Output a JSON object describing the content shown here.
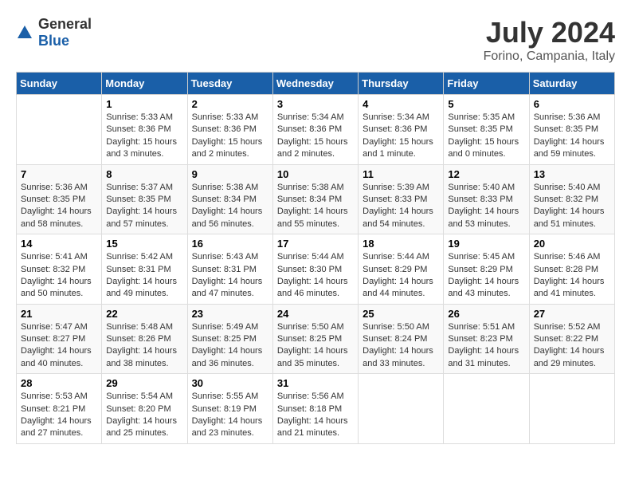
{
  "logo": {
    "general": "General",
    "blue": "Blue"
  },
  "header": {
    "month_year": "July 2024",
    "location": "Forino, Campania, Italy"
  },
  "weekdays": [
    "Sunday",
    "Monday",
    "Tuesday",
    "Wednesday",
    "Thursday",
    "Friday",
    "Saturday"
  ],
  "weeks": [
    [
      {
        "day": "",
        "sunrise": "",
        "sunset": "",
        "daylight": ""
      },
      {
        "day": "1",
        "sunrise": "Sunrise: 5:33 AM",
        "sunset": "Sunset: 8:36 PM",
        "daylight": "Daylight: 15 hours and 3 minutes."
      },
      {
        "day": "2",
        "sunrise": "Sunrise: 5:33 AM",
        "sunset": "Sunset: 8:36 PM",
        "daylight": "Daylight: 15 hours and 2 minutes."
      },
      {
        "day": "3",
        "sunrise": "Sunrise: 5:34 AM",
        "sunset": "Sunset: 8:36 PM",
        "daylight": "Daylight: 15 hours and 2 minutes."
      },
      {
        "day": "4",
        "sunrise": "Sunrise: 5:34 AM",
        "sunset": "Sunset: 8:36 PM",
        "daylight": "Daylight: 15 hours and 1 minute."
      },
      {
        "day": "5",
        "sunrise": "Sunrise: 5:35 AM",
        "sunset": "Sunset: 8:35 PM",
        "daylight": "Daylight: 15 hours and 0 minutes."
      },
      {
        "day": "6",
        "sunrise": "Sunrise: 5:36 AM",
        "sunset": "Sunset: 8:35 PM",
        "daylight": "Daylight: 14 hours and 59 minutes."
      }
    ],
    [
      {
        "day": "7",
        "sunrise": "Sunrise: 5:36 AM",
        "sunset": "Sunset: 8:35 PM",
        "daylight": "Daylight: 14 hours and 58 minutes."
      },
      {
        "day": "8",
        "sunrise": "Sunrise: 5:37 AM",
        "sunset": "Sunset: 8:35 PM",
        "daylight": "Daylight: 14 hours and 57 minutes."
      },
      {
        "day": "9",
        "sunrise": "Sunrise: 5:38 AM",
        "sunset": "Sunset: 8:34 PM",
        "daylight": "Daylight: 14 hours and 56 minutes."
      },
      {
        "day": "10",
        "sunrise": "Sunrise: 5:38 AM",
        "sunset": "Sunset: 8:34 PM",
        "daylight": "Daylight: 14 hours and 55 minutes."
      },
      {
        "day": "11",
        "sunrise": "Sunrise: 5:39 AM",
        "sunset": "Sunset: 8:33 PM",
        "daylight": "Daylight: 14 hours and 54 minutes."
      },
      {
        "day": "12",
        "sunrise": "Sunrise: 5:40 AM",
        "sunset": "Sunset: 8:33 PM",
        "daylight": "Daylight: 14 hours and 53 minutes."
      },
      {
        "day": "13",
        "sunrise": "Sunrise: 5:40 AM",
        "sunset": "Sunset: 8:32 PM",
        "daylight": "Daylight: 14 hours and 51 minutes."
      }
    ],
    [
      {
        "day": "14",
        "sunrise": "Sunrise: 5:41 AM",
        "sunset": "Sunset: 8:32 PM",
        "daylight": "Daylight: 14 hours and 50 minutes."
      },
      {
        "day": "15",
        "sunrise": "Sunrise: 5:42 AM",
        "sunset": "Sunset: 8:31 PM",
        "daylight": "Daylight: 14 hours and 49 minutes."
      },
      {
        "day": "16",
        "sunrise": "Sunrise: 5:43 AM",
        "sunset": "Sunset: 8:31 PM",
        "daylight": "Daylight: 14 hours and 47 minutes."
      },
      {
        "day": "17",
        "sunrise": "Sunrise: 5:44 AM",
        "sunset": "Sunset: 8:30 PM",
        "daylight": "Daylight: 14 hours and 46 minutes."
      },
      {
        "day": "18",
        "sunrise": "Sunrise: 5:44 AM",
        "sunset": "Sunset: 8:29 PM",
        "daylight": "Daylight: 14 hours and 44 minutes."
      },
      {
        "day": "19",
        "sunrise": "Sunrise: 5:45 AM",
        "sunset": "Sunset: 8:29 PM",
        "daylight": "Daylight: 14 hours and 43 minutes."
      },
      {
        "day": "20",
        "sunrise": "Sunrise: 5:46 AM",
        "sunset": "Sunset: 8:28 PM",
        "daylight": "Daylight: 14 hours and 41 minutes."
      }
    ],
    [
      {
        "day": "21",
        "sunrise": "Sunrise: 5:47 AM",
        "sunset": "Sunset: 8:27 PM",
        "daylight": "Daylight: 14 hours and 40 minutes."
      },
      {
        "day": "22",
        "sunrise": "Sunrise: 5:48 AM",
        "sunset": "Sunset: 8:26 PM",
        "daylight": "Daylight: 14 hours and 38 minutes."
      },
      {
        "day": "23",
        "sunrise": "Sunrise: 5:49 AM",
        "sunset": "Sunset: 8:25 PM",
        "daylight": "Daylight: 14 hours and 36 minutes."
      },
      {
        "day": "24",
        "sunrise": "Sunrise: 5:50 AM",
        "sunset": "Sunset: 8:25 PM",
        "daylight": "Daylight: 14 hours and 35 minutes."
      },
      {
        "day": "25",
        "sunrise": "Sunrise: 5:50 AM",
        "sunset": "Sunset: 8:24 PM",
        "daylight": "Daylight: 14 hours and 33 minutes."
      },
      {
        "day": "26",
        "sunrise": "Sunrise: 5:51 AM",
        "sunset": "Sunset: 8:23 PM",
        "daylight": "Daylight: 14 hours and 31 minutes."
      },
      {
        "day": "27",
        "sunrise": "Sunrise: 5:52 AM",
        "sunset": "Sunset: 8:22 PM",
        "daylight": "Daylight: 14 hours and 29 minutes."
      }
    ],
    [
      {
        "day": "28",
        "sunrise": "Sunrise: 5:53 AM",
        "sunset": "Sunset: 8:21 PM",
        "daylight": "Daylight: 14 hours and 27 minutes."
      },
      {
        "day": "29",
        "sunrise": "Sunrise: 5:54 AM",
        "sunset": "Sunset: 8:20 PM",
        "daylight": "Daylight: 14 hours and 25 minutes."
      },
      {
        "day": "30",
        "sunrise": "Sunrise: 5:55 AM",
        "sunset": "Sunset: 8:19 PM",
        "daylight": "Daylight: 14 hours and 23 minutes."
      },
      {
        "day": "31",
        "sunrise": "Sunrise: 5:56 AM",
        "sunset": "Sunset: 8:18 PM",
        "daylight": "Daylight: 14 hours and 21 minutes."
      },
      {
        "day": "",
        "sunrise": "",
        "sunset": "",
        "daylight": ""
      },
      {
        "day": "",
        "sunrise": "",
        "sunset": "",
        "daylight": ""
      },
      {
        "day": "",
        "sunrise": "",
        "sunset": "",
        "daylight": ""
      }
    ]
  ]
}
